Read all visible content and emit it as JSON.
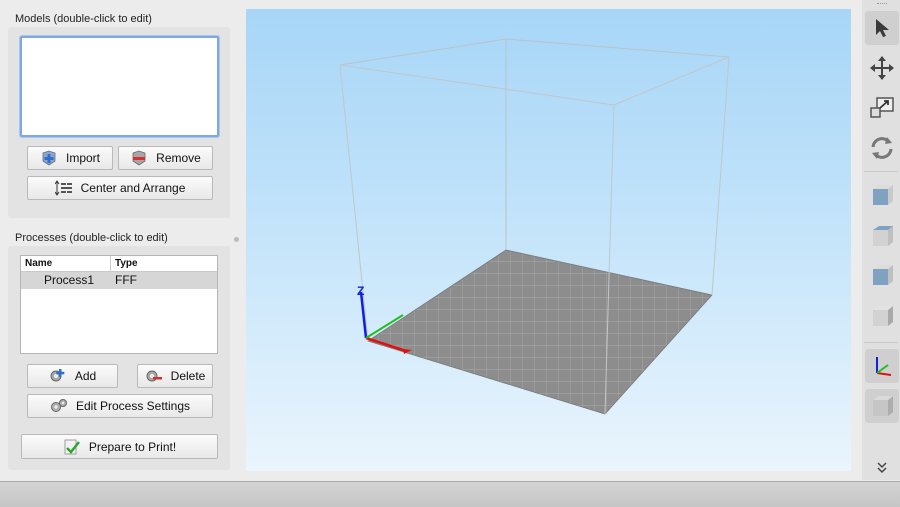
{
  "models": {
    "title": "Models (double-click to edit)",
    "import_label": "Import",
    "remove_label": "Remove",
    "center_arrange_label": "Center and Arrange"
  },
  "processes": {
    "title": "Processes (double-click to edit)",
    "columns": [
      "Name",
      "Type"
    ],
    "rows": [
      {
        "name": "Process1",
        "type": "FFF"
      }
    ],
    "add_label": "Add",
    "delete_label": "Delete",
    "edit_settings_label": "Edit Process Settings",
    "prepare_label": "Prepare to Print!"
  },
  "viewport": {
    "axis_label": "Z"
  },
  "colors": {
    "accent": "#7fa7e0",
    "bed": "#8a8a8a",
    "axis_x": "#e01010",
    "axis_y": "#20c020",
    "axis_z": "#1020e0"
  },
  "toolbar": {
    "tools": [
      {
        "name": "select-tool",
        "icon": "arrow-cursor-icon"
      },
      {
        "name": "move-tool",
        "icon": "move-arrows-icon"
      },
      {
        "name": "scale-tool",
        "icon": "scale-icon"
      },
      {
        "name": "rotate-tool",
        "icon": "rotate-icon"
      },
      {
        "name": "view-front",
        "icon": "cube-front-icon"
      },
      {
        "name": "view-top",
        "icon": "cube-top-icon"
      },
      {
        "name": "view-left",
        "icon": "cube-left-icon"
      },
      {
        "name": "view-right",
        "icon": "cube-right-icon"
      },
      {
        "name": "view-axes",
        "icon": "axes-icon"
      },
      {
        "name": "view-iso",
        "icon": "cube-iso-icon"
      }
    ],
    "more_icon": "double-chevron-down-icon"
  }
}
